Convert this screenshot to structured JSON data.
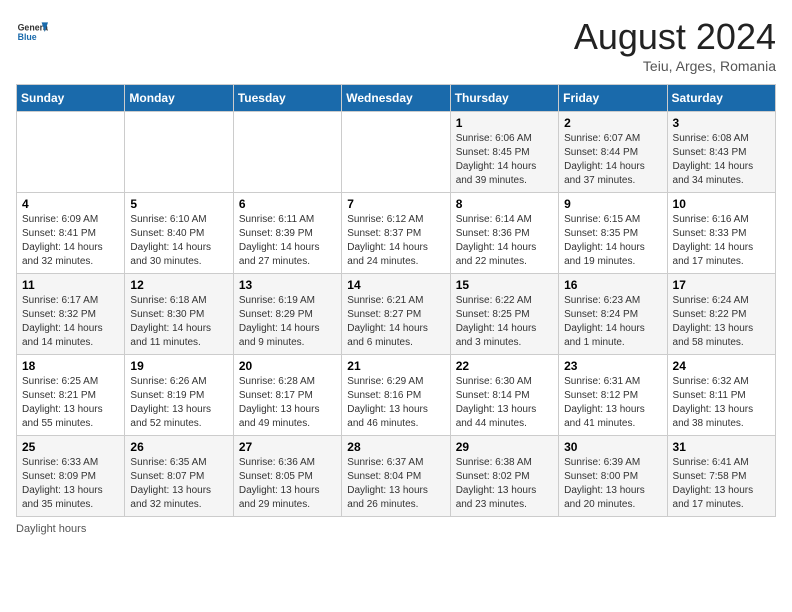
{
  "header": {
    "logo_general": "General",
    "logo_blue": "Blue",
    "month_title": "August 2024",
    "subtitle": "Teiu, Arges, Romania"
  },
  "footer": {
    "daylight_label": "Daylight hours"
  },
  "weekdays": [
    "Sunday",
    "Monday",
    "Tuesday",
    "Wednesday",
    "Thursday",
    "Friday",
    "Saturday"
  ],
  "weeks": [
    [
      {
        "day": "",
        "info": ""
      },
      {
        "day": "",
        "info": ""
      },
      {
        "day": "",
        "info": ""
      },
      {
        "day": "",
        "info": ""
      },
      {
        "day": "1",
        "info": "Sunrise: 6:06 AM\nSunset: 8:45 PM\nDaylight: 14 hours and 39 minutes."
      },
      {
        "day": "2",
        "info": "Sunrise: 6:07 AM\nSunset: 8:44 PM\nDaylight: 14 hours and 37 minutes."
      },
      {
        "day": "3",
        "info": "Sunrise: 6:08 AM\nSunset: 8:43 PM\nDaylight: 14 hours and 34 minutes."
      }
    ],
    [
      {
        "day": "4",
        "info": "Sunrise: 6:09 AM\nSunset: 8:41 PM\nDaylight: 14 hours and 32 minutes."
      },
      {
        "day": "5",
        "info": "Sunrise: 6:10 AM\nSunset: 8:40 PM\nDaylight: 14 hours and 30 minutes."
      },
      {
        "day": "6",
        "info": "Sunrise: 6:11 AM\nSunset: 8:39 PM\nDaylight: 14 hours and 27 minutes."
      },
      {
        "day": "7",
        "info": "Sunrise: 6:12 AM\nSunset: 8:37 PM\nDaylight: 14 hours and 24 minutes."
      },
      {
        "day": "8",
        "info": "Sunrise: 6:14 AM\nSunset: 8:36 PM\nDaylight: 14 hours and 22 minutes."
      },
      {
        "day": "9",
        "info": "Sunrise: 6:15 AM\nSunset: 8:35 PM\nDaylight: 14 hours and 19 minutes."
      },
      {
        "day": "10",
        "info": "Sunrise: 6:16 AM\nSunset: 8:33 PM\nDaylight: 14 hours and 17 minutes."
      }
    ],
    [
      {
        "day": "11",
        "info": "Sunrise: 6:17 AM\nSunset: 8:32 PM\nDaylight: 14 hours and 14 minutes."
      },
      {
        "day": "12",
        "info": "Sunrise: 6:18 AM\nSunset: 8:30 PM\nDaylight: 14 hours and 11 minutes."
      },
      {
        "day": "13",
        "info": "Sunrise: 6:19 AM\nSunset: 8:29 PM\nDaylight: 14 hours and 9 minutes."
      },
      {
        "day": "14",
        "info": "Sunrise: 6:21 AM\nSunset: 8:27 PM\nDaylight: 14 hours and 6 minutes."
      },
      {
        "day": "15",
        "info": "Sunrise: 6:22 AM\nSunset: 8:25 PM\nDaylight: 14 hours and 3 minutes."
      },
      {
        "day": "16",
        "info": "Sunrise: 6:23 AM\nSunset: 8:24 PM\nDaylight: 14 hours and 1 minute."
      },
      {
        "day": "17",
        "info": "Sunrise: 6:24 AM\nSunset: 8:22 PM\nDaylight: 13 hours and 58 minutes."
      }
    ],
    [
      {
        "day": "18",
        "info": "Sunrise: 6:25 AM\nSunset: 8:21 PM\nDaylight: 13 hours and 55 minutes."
      },
      {
        "day": "19",
        "info": "Sunrise: 6:26 AM\nSunset: 8:19 PM\nDaylight: 13 hours and 52 minutes."
      },
      {
        "day": "20",
        "info": "Sunrise: 6:28 AM\nSunset: 8:17 PM\nDaylight: 13 hours and 49 minutes."
      },
      {
        "day": "21",
        "info": "Sunrise: 6:29 AM\nSunset: 8:16 PM\nDaylight: 13 hours and 46 minutes."
      },
      {
        "day": "22",
        "info": "Sunrise: 6:30 AM\nSunset: 8:14 PM\nDaylight: 13 hours and 44 minutes."
      },
      {
        "day": "23",
        "info": "Sunrise: 6:31 AM\nSunset: 8:12 PM\nDaylight: 13 hours and 41 minutes."
      },
      {
        "day": "24",
        "info": "Sunrise: 6:32 AM\nSunset: 8:11 PM\nDaylight: 13 hours and 38 minutes."
      }
    ],
    [
      {
        "day": "25",
        "info": "Sunrise: 6:33 AM\nSunset: 8:09 PM\nDaylight: 13 hours and 35 minutes."
      },
      {
        "day": "26",
        "info": "Sunrise: 6:35 AM\nSunset: 8:07 PM\nDaylight: 13 hours and 32 minutes."
      },
      {
        "day": "27",
        "info": "Sunrise: 6:36 AM\nSunset: 8:05 PM\nDaylight: 13 hours and 29 minutes."
      },
      {
        "day": "28",
        "info": "Sunrise: 6:37 AM\nSunset: 8:04 PM\nDaylight: 13 hours and 26 minutes."
      },
      {
        "day": "29",
        "info": "Sunrise: 6:38 AM\nSunset: 8:02 PM\nDaylight: 13 hours and 23 minutes."
      },
      {
        "day": "30",
        "info": "Sunrise: 6:39 AM\nSunset: 8:00 PM\nDaylight: 13 hours and 20 minutes."
      },
      {
        "day": "31",
        "info": "Sunrise: 6:41 AM\nSunset: 7:58 PM\nDaylight: 13 hours and 17 minutes."
      }
    ]
  ]
}
